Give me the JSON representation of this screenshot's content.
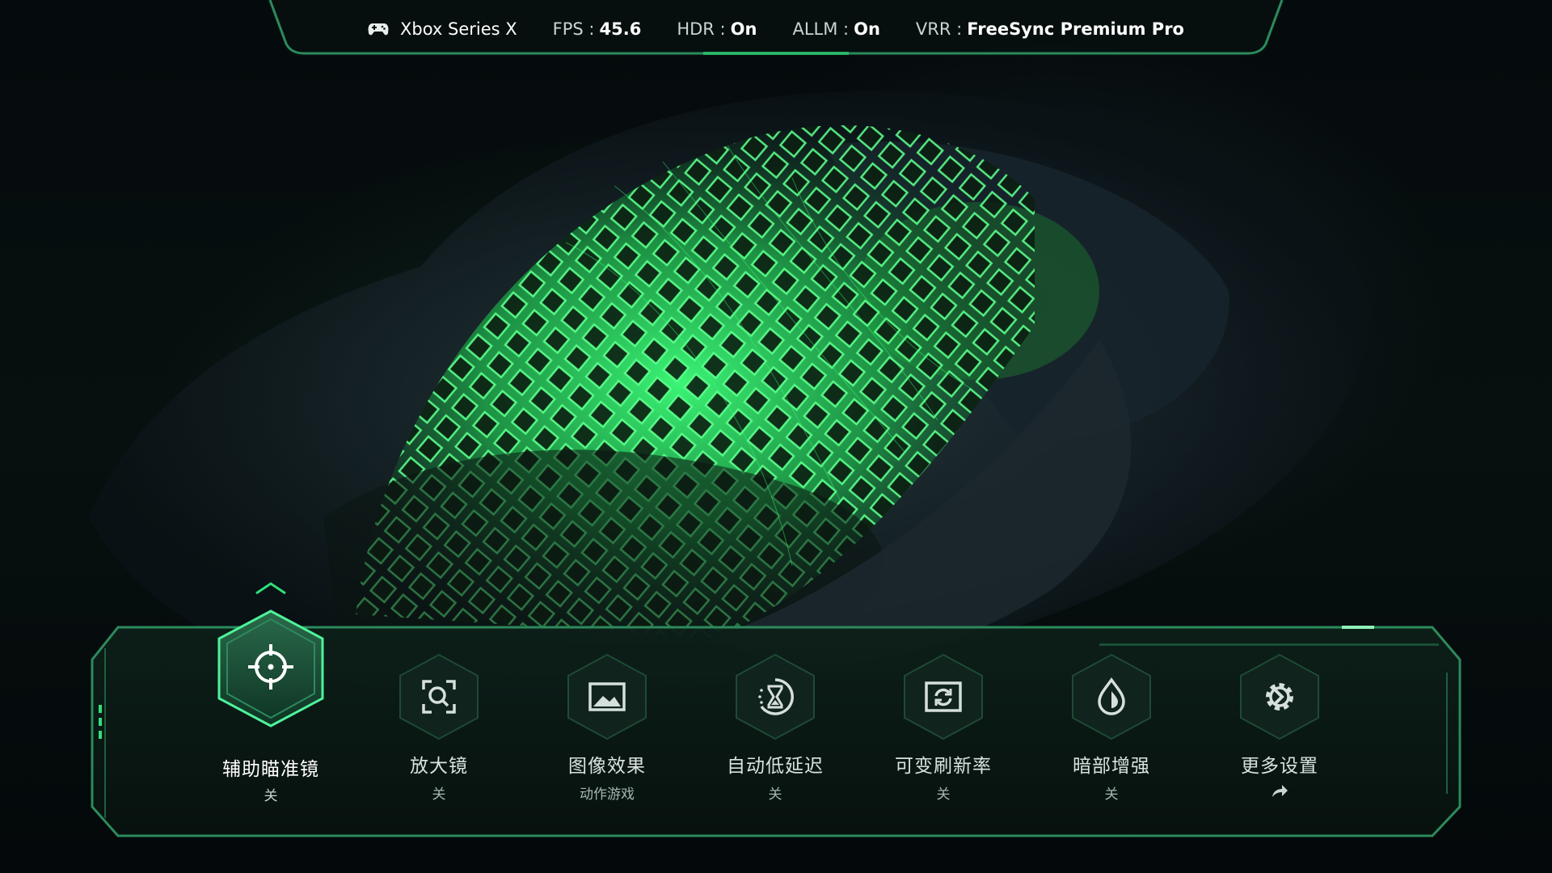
{
  "status_bar": {
    "device": "Xbox Series X",
    "fps": {
      "label": "FPS :",
      "value": "45.6"
    },
    "hdr": {
      "label": "HDR :",
      "value": "On"
    },
    "allm": {
      "label": "ALLM :",
      "value": "On"
    },
    "vrr": {
      "label": "VRR :",
      "value": "FreeSync Premium Pro"
    }
  },
  "menu": {
    "items": [
      {
        "label": "辅助瞄准镜",
        "sub": "关",
        "icon": "crosshair-icon",
        "active": true
      },
      {
        "label": "放大镜",
        "sub": "关",
        "icon": "magnifier-icon",
        "active": false
      },
      {
        "label": "图像效果",
        "sub": "动作游戏",
        "icon": "image-icon",
        "active": false
      },
      {
        "label": "自动低延迟",
        "sub": "关",
        "icon": "hourglass-icon",
        "active": false
      },
      {
        "label": "可变刷新率",
        "sub": "关",
        "icon": "refresh-icon",
        "active": false
      },
      {
        "label": "暗部增强",
        "sub": "关",
        "icon": "droplet-icon",
        "active": false
      },
      {
        "label": "更多设置",
        "sub": "",
        "icon": "gear-icon",
        "active": false
      }
    ]
  },
  "colors": {
    "accent": "#2fe07a",
    "panel": "#0b1a16",
    "frame": "#2c8a5c"
  }
}
